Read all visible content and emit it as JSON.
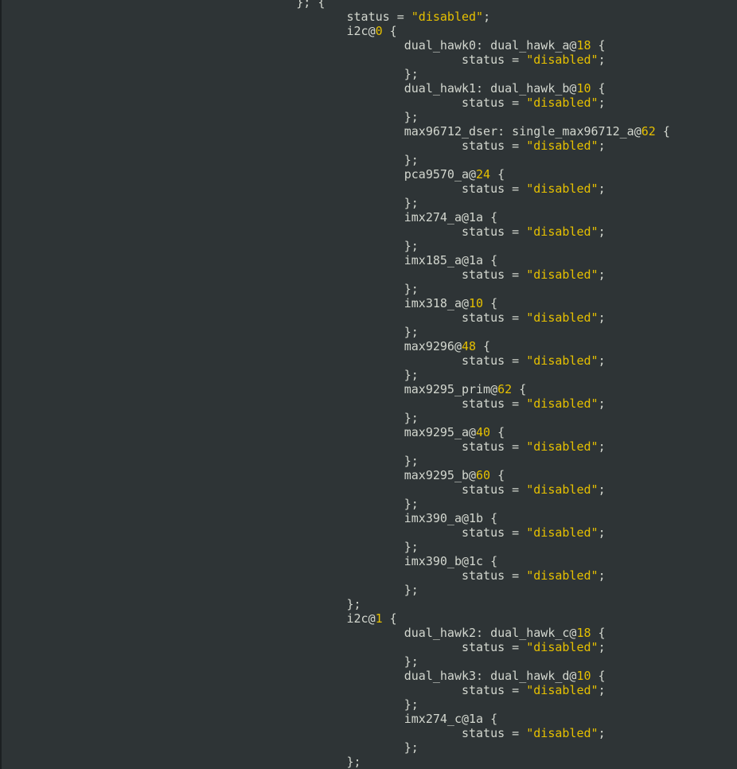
{
  "editor": {
    "lines": [
      {
        "segments": [
          {
            "t": "                                         }; {",
            "k": "plain"
          }
        ]
      },
      {
        "segments": [
          {
            "t": "                                                status = ",
            "k": "plain"
          },
          {
            "t": "\"disabled\"",
            "k": "str"
          },
          {
            "t": ";",
            "k": "plain"
          }
        ]
      },
      {
        "segments": [
          {
            "t": "                                                i2c@",
            "k": "plain"
          },
          {
            "t": "0",
            "k": "num"
          },
          {
            "t": " {",
            "k": "plain"
          }
        ]
      },
      {
        "segments": [
          {
            "t": "                                                        dual_hawk0: dual_hawk_a@",
            "k": "plain"
          },
          {
            "t": "18",
            "k": "num"
          },
          {
            "t": " {",
            "k": "plain"
          }
        ]
      },
      {
        "segments": [
          {
            "t": "                                                                status = ",
            "k": "plain"
          },
          {
            "t": "\"disabled\"",
            "k": "str"
          },
          {
            "t": ";",
            "k": "plain"
          }
        ]
      },
      {
        "segments": [
          {
            "t": "                                                        };",
            "k": "plain"
          }
        ]
      },
      {
        "segments": [
          {
            "t": "                                                        dual_hawk1: dual_hawk_b@",
            "k": "plain"
          },
          {
            "t": "10",
            "k": "num"
          },
          {
            "t": " {",
            "k": "plain"
          }
        ]
      },
      {
        "segments": [
          {
            "t": "                                                                status = ",
            "k": "plain"
          },
          {
            "t": "\"disabled\"",
            "k": "str"
          },
          {
            "t": ";",
            "k": "plain"
          }
        ]
      },
      {
        "segments": [
          {
            "t": "                                                        };",
            "k": "plain"
          }
        ]
      },
      {
        "segments": [
          {
            "t": "                                                        max96712_dser: single_max96712_a@",
            "k": "plain"
          },
          {
            "t": "62",
            "k": "num"
          },
          {
            "t": " {",
            "k": "plain"
          }
        ]
      },
      {
        "segments": [
          {
            "t": "                                                                status = ",
            "k": "plain"
          },
          {
            "t": "\"disabled\"",
            "k": "str"
          },
          {
            "t": ";",
            "k": "plain"
          }
        ]
      },
      {
        "segments": [
          {
            "t": "                                                        };",
            "k": "plain"
          }
        ]
      },
      {
        "segments": [
          {
            "t": "                                                        pca9570_a@",
            "k": "plain"
          },
          {
            "t": "24",
            "k": "num"
          },
          {
            "t": " {",
            "k": "plain"
          }
        ]
      },
      {
        "segments": [
          {
            "t": "                                                                status = ",
            "k": "plain"
          },
          {
            "t": "\"disabled\"",
            "k": "str"
          },
          {
            "t": ";",
            "k": "plain"
          }
        ]
      },
      {
        "segments": [
          {
            "t": "                                                        };",
            "k": "plain"
          }
        ]
      },
      {
        "segments": [
          {
            "t": "                                                        imx274_a@1a {",
            "k": "plain"
          }
        ]
      },
      {
        "segments": [
          {
            "t": "                                                                status = ",
            "k": "plain"
          },
          {
            "t": "\"disabled\"",
            "k": "str"
          },
          {
            "t": ";",
            "k": "plain"
          }
        ]
      },
      {
        "segments": [
          {
            "t": "                                                        };",
            "k": "plain"
          }
        ]
      },
      {
        "segments": [
          {
            "t": "                                                        imx185_a@1a {",
            "k": "plain"
          }
        ]
      },
      {
        "segments": [
          {
            "t": "                                                                status = ",
            "k": "plain"
          },
          {
            "t": "\"disabled\"",
            "k": "str"
          },
          {
            "t": ";",
            "k": "plain"
          }
        ]
      },
      {
        "segments": [
          {
            "t": "                                                        };",
            "k": "plain"
          }
        ]
      },
      {
        "segments": [
          {
            "t": "                                                        imx318_a@",
            "k": "plain"
          },
          {
            "t": "10",
            "k": "num"
          },
          {
            "t": " {",
            "k": "plain"
          }
        ]
      },
      {
        "segments": [
          {
            "t": "                                                                status = ",
            "k": "plain"
          },
          {
            "t": "\"disabled\"",
            "k": "str"
          },
          {
            "t": ";",
            "k": "plain"
          }
        ]
      },
      {
        "segments": [
          {
            "t": "                                                        };",
            "k": "plain"
          }
        ]
      },
      {
        "segments": [
          {
            "t": "                                                        max9296@",
            "k": "plain"
          },
          {
            "t": "48",
            "k": "num"
          },
          {
            "t": " {",
            "k": "plain"
          }
        ]
      },
      {
        "segments": [
          {
            "t": "                                                                status = ",
            "k": "plain"
          },
          {
            "t": "\"disabled\"",
            "k": "str"
          },
          {
            "t": ";",
            "k": "plain"
          }
        ]
      },
      {
        "segments": [
          {
            "t": "                                                        };",
            "k": "plain"
          }
        ]
      },
      {
        "segments": [
          {
            "t": "                                                        max9295_prim@",
            "k": "plain"
          },
          {
            "t": "62",
            "k": "num"
          },
          {
            "t": " {",
            "k": "plain"
          }
        ]
      },
      {
        "segments": [
          {
            "t": "                                                                status = ",
            "k": "plain"
          },
          {
            "t": "\"disabled\"",
            "k": "str"
          },
          {
            "t": ";",
            "k": "plain"
          }
        ]
      },
      {
        "segments": [
          {
            "t": "                                                        };",
            "k": "plain"
          }
        ]
      },
      {
        "segments": [
          {
            "t": "                                                        max9295_a@",
            "k": "plain"
          },
          {
            "t": "40",
            "k": "num"
          },
          {
            "t": " {",
            "k": "plain"
          }
        ]
      },
      {
        "segments": [
          {
            "t": "                                                                status = ",
            "k": "plain"
          },
          {
            "t": "\"disabled\"",
            "k": "str"
          },
          {
            "t": ";",
            "k": "plain"
          }
        ]
      },
      {
        "segments": [
          {
            "t": "                                                        };",
            "k": "plain"
          }
        ]
      },
      {
        "segments": [
          {
            "t": "                                                        max9295_b@",
            "k": "plain"
          },
          {
            "t": "60",
            "k": "num"
          },
          {
            "t": " {",
            "k": "plain"
          }
        ]
      },
      {
        "segments": [
          {
            "t": "                                                                status = ",
            "k": "plain"
          },
          {
            "t": "\"disabled\"",
            "k": "str"
          },
          {
            "t": ";",
            "k": "plain"
          }
        ]
      },
      {
        "segments": [
          {
            "t": "                                                        };",
            "k": "plain"
          }
        ]
      },
      {
        "segments": [
          {
            "t": "                                                        imx390_a@1b {",
            "k": "plain"
          }
        ]
      },
      {
        "segments": [
          {
            "t": "                                                                status = ",
            "k": "plain"
          },
          {
            "t": "\"disabled\"",
            "k": "str"
          },
          {
            "t": ";",
            "k": "plain"
          }
        ]
      },
      {
        "segments": [
          {
            "t": "                                                        };",
            "k": "plain"
          }
        ]
      },
      {
        "segments": [
          {
            "t": "                                                        imx390_b@1c {",
            "k": "plain"
          }
        ]
      },
      {
        "segments": [
          {
            "t": "                                                                status = ",
            "k": "plain"
          },
          {
            "t": "\"disabled\"",
            "k": "str"
          },
          {
            "t": ";",
            "k": "plain"
          }
        ]
      },
      {
        "segments": [
          {
            "t": "                                                        };",
            "k": "plain"
          }
        ]
      },
      {
        "segments": [
          {
            "t": "                                                };",
            "k": "plain"
          }
        ]
      },
      {
        "segments": [
          {
            "t": "                                                i2c@",
            "k": "plain"
          },
          {
            "t": "1",
            "k": "num"
          },
          {
            "t": " {",
            "k": "plain"
          }
        ]
      },
      {
        "segments": [
          {
            "t": "                                                        dual_hawk2: dual_hawk_c@",
            "k": "plain"
          },
          {
            "t": "18",
            "k": "num"
          },
          {
            "t": " {",
            "k": "plain"
          }
        ]
      },
      {
        "segments": [
          {
            "t": "                                                                status = ",
            "k": "plain"
          },
          {
            "t": "\"disabled\"",
            "k": "str"
          },
          {
            "t": ";",
            "k": "plain"
          }
        ]
      },
      {
        "segments": [
          {
            "t": "                                                        };",
            "k": "plain"
          }
        ]
      },
      {
        "segments": [
          {
            "t": "                                                        dual_hawk3: dual_hawk_d@",
            "k": "plain"
          },
          {
            "t": "10",
            "k": "num"
          },
          {
            "t": " {",
            "k": "plain"
          }
        ]
      },
      {
        "segments": [
          {
            "t": "                                                                status = ",
            "k": "plain"
          },
          {
            "t": "\"disabled\"",
            "k": "str"
          },
          {
            "t": ";",
            "k": "plain"
          }
        ]
      },
      {
        "segments": [
          {
            "t": "                                                        };",
            "k": "plain"
          }
        ]
      },
      {
        "segments": [
          {
            "t": "                                                        imx274_c@1a {",
            "k": "plain"
          }
        ]
      },
      {
        "segments": [
          {
            "t": "                                                                status = ",
            "k": "plain"
          },
          {
            "t": "\"disabled\"",
            "k": "str"
          },
          {
            "t": ";",
            "k": "plain"
          }
        ]
      },
      {
        "segments": [
          {
            "t": "                                                        };",
            "k": "plain"
          }
        ]
      },
      {
        "segments": [
          {
            "t": "                                                };",
            "k": "plain"
          }
        ]
      },
      {
        "segments": [
          {
            "t": "                                        };",
            "k": "plain"
          }
        ]
      }
    ]
  },
  "colors": {
    "background": "#2e3436",
    "text": "#d3d7cf",
    "number": "#e6c000",
    "string": "#e6c000"
  }
}
